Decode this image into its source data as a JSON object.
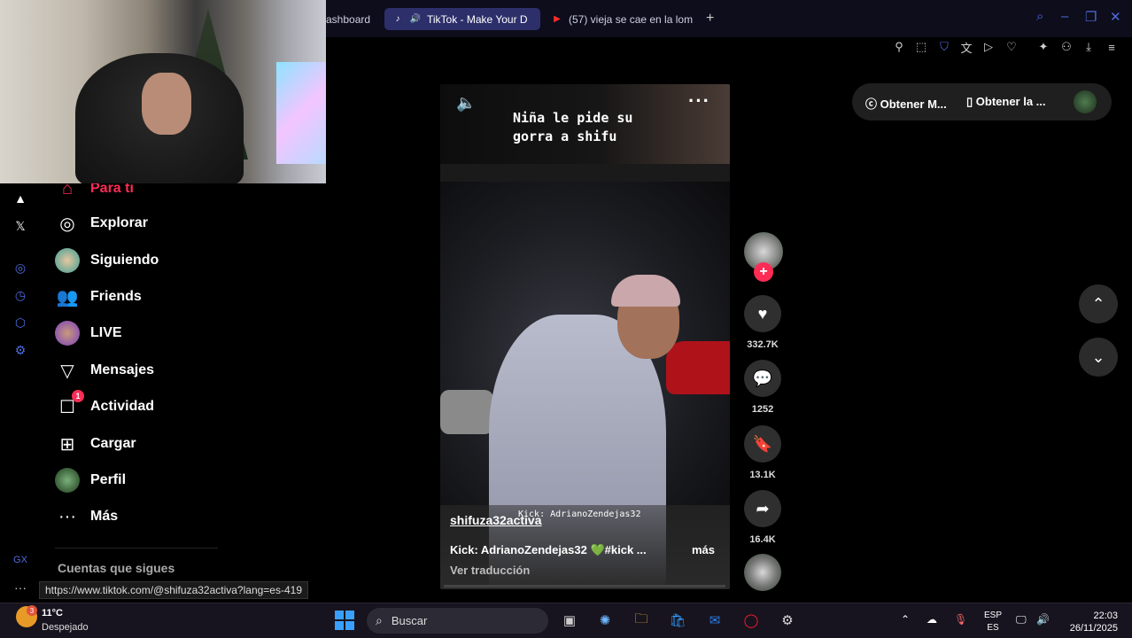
{
  "browser": {
    "tabs": [
      {
        "label": "ashboard"
      },
      {
        "label": "TikTok - Make Your D"
      },
      {
        "label": "(57) vieja se cae en la lom"
      }
    ]
  },
  "sidebar": {
    "items": [
      {
        "label": "Para ti"
      },
      {
        "label": "Explorar"
      },
      {
        "label": "Siguiendo"
      },
      {
        "label": "Friends"
      },
      {
        "label": "LIVE"
      },
      {
        "label": "Mensajes"
      },
      {
        "label": "Actividad",
        "badge": "1"
      },
      {
        "label": "Cargar"
      },
      {
        "label": "Perfil"
      },
      {
        "label": "Más"
      }
    ],
    "following_heading": "Cuentas que sigues"
  },
  "status_url": "https://www.tiktok.com/@shifuza32activa?lang=es-419",
  "video": {
    "caption": "Niña le pide su gorra a shifu",
    "author": "shifuza32activa",
    "overlay_text": "Kick: AdrianoZendejas32",
    "description": "Kick: AdrianoZendejas32 💚#kick ...",
    "more_label": "más",
    "translate_label": "Ver traducción"
  },
  "actions": {
    "likes": "332.7K",
    "comments": "1252",
    "saves": "13.1K",
    "shares": "16.4K"
  },
  "top_right": {
    "btn1": "Obtener M...",
    "btn2": "Obtener la ..."
  },
  "taskbar": {
    "weather_temp": "11°C",
    "weather_cond": "Despejado",
    "weather_badge": "3",
    "search_placeholder": "Buscar",
    "lang_top": "ESP",
    "lang_bottom": "ES",
    "time": "22:03",
    "date": "26/11/2025"
  },
  "colors": {
    "accent_pink": "#fe2c55",
    "browser_accent": "#4f6bdc"
  }
}
